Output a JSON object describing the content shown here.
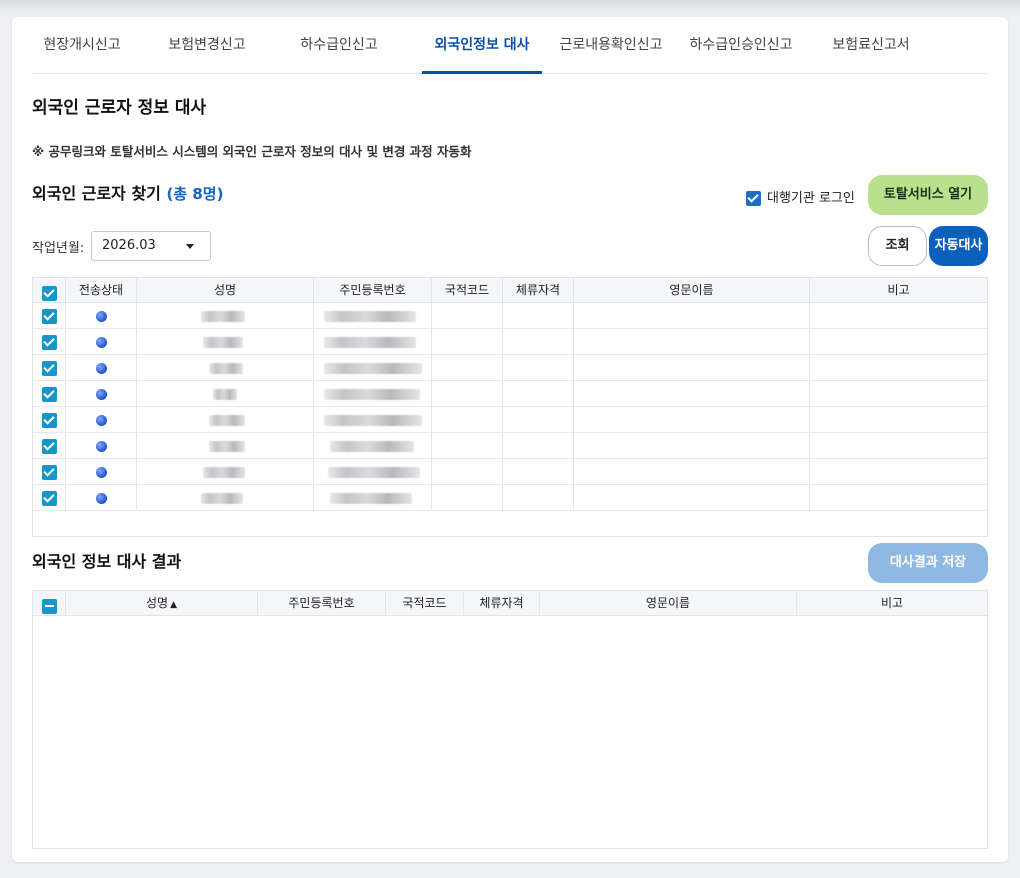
{
  "tabs": [
    {
      "label": "현장개시신고",
      "active": false
    },
    {
      "label": "보험변경신고",
      "active": false
    },
    {
      "label": "하수급인신고",
      "active": false
    },
    {
      "label": "외국인정보 대사",
      "active": true
    },
    {
      "label": "근로내용확인신고",
      "active": false
    },
    {
      "label": "하수급인승인신고",
      "active": false
    },
    {
      "label": "보험료신고서",
      "active": false
    }
  ],
  "page": {
    "title": "외국인 근로자 정보 대사",
    "note": "※ 공무링크와 토탈서비스 시스템의 외국인 근로자 정보의 대사 및 변경 과정 자동화"
  },
  "finder": {
    "title": "외국인 근로자 찾기",
    "count": "(총 8명)",
    "agency_login_label": "대행기관 로그인",
    "agency_login_checked": true,
    "open_total_service": "토탈서비스 열기",
    "month_label": "작업년월:",
    "month_value": "2026.03",
    "search_button": "조회",
    "auto_button": "자동대사",
    "columns": [
      "전송상태",
      "성명",
      "주민등록번호",
      "국적코드",
      "체류자격",
      "영문이름",
      "비고"
    ],
    "rows": [
      {
        "checked": true,
        "status": "blue-dot",
        "name": "(blurred)",
        "rrn": "(blurred)",
        "nation": "",
        "visa": "",
        "english_name": "",
        "remark": ""
      },
      {
        "checked": true,
        "status": "blue-dot",
        "name": "(blurred)",
        "rrn": "(blurred)",
        "nation": "",
        "visa": "",
        "english_name": "",
        "remark": ""
      },
      {
        "checked": true,
        "status": "blue-dot",
        "name": "(blurred)",
        "rrn": "(blurred)",
        "nation": "",
        "visa": "",
        "english_name": "",
        "remark": ""
      },
      {
        "checked": true,
        "status": "blue-dot",
        "name": "(blurred)",
        "rrn": "(blurred)",
        "nation": "",
        "visa": "",
        "english_name": "",
        "remark": ""
      },
      {
        "checked": true,
        "status": "blue-dot",
        "name": "(blurred)",
        "rrn": "(blurred)",
        "nation": "",
        "visa": "",
        "english_name": "",
        "remark": ""
      },
      {
        "checked": true,
        "status": "blue-dot",
        "name": "(blurred)",
        "rrn": "(blurred)",
        "nation": "",
        "visa": "",
        "english_name": "",
        "remark": ""
      },
      {
        "checked": true,
        "status": "blue-dot",
        "name": "(blurred)",
        "rrn": "(blurred)",
        "nation": "",
        "visa": "",
        "english_name": "",
        "remark": ""
      },
      {
        "checked": true,
        "status": "blue-dot",
        "name": "(blurred)",
        "rrn": "(blurred)",
        "nation": "",
        "visa": "",
        "english_name": "",
        "remark": ""
      }
    ]
  },
  "result": {
    "title": "외국인 정보 대사 결과",
    "save_button": "대사결과 저장",
    "columns": [
      "성명",
      "주민등록번호",
      "국적코드",
      "체류자격",
      "영문이름",
      "비고"
    ],
    "sort_indicator": "▲"
  },
  "colors": {
    "accent": "#0b4fa3",
    "checkbox": "#1a6fc4",
    "green_button": "#b9e08d",
    "save_button_disabled": "#8fb8e3"
  }
}
